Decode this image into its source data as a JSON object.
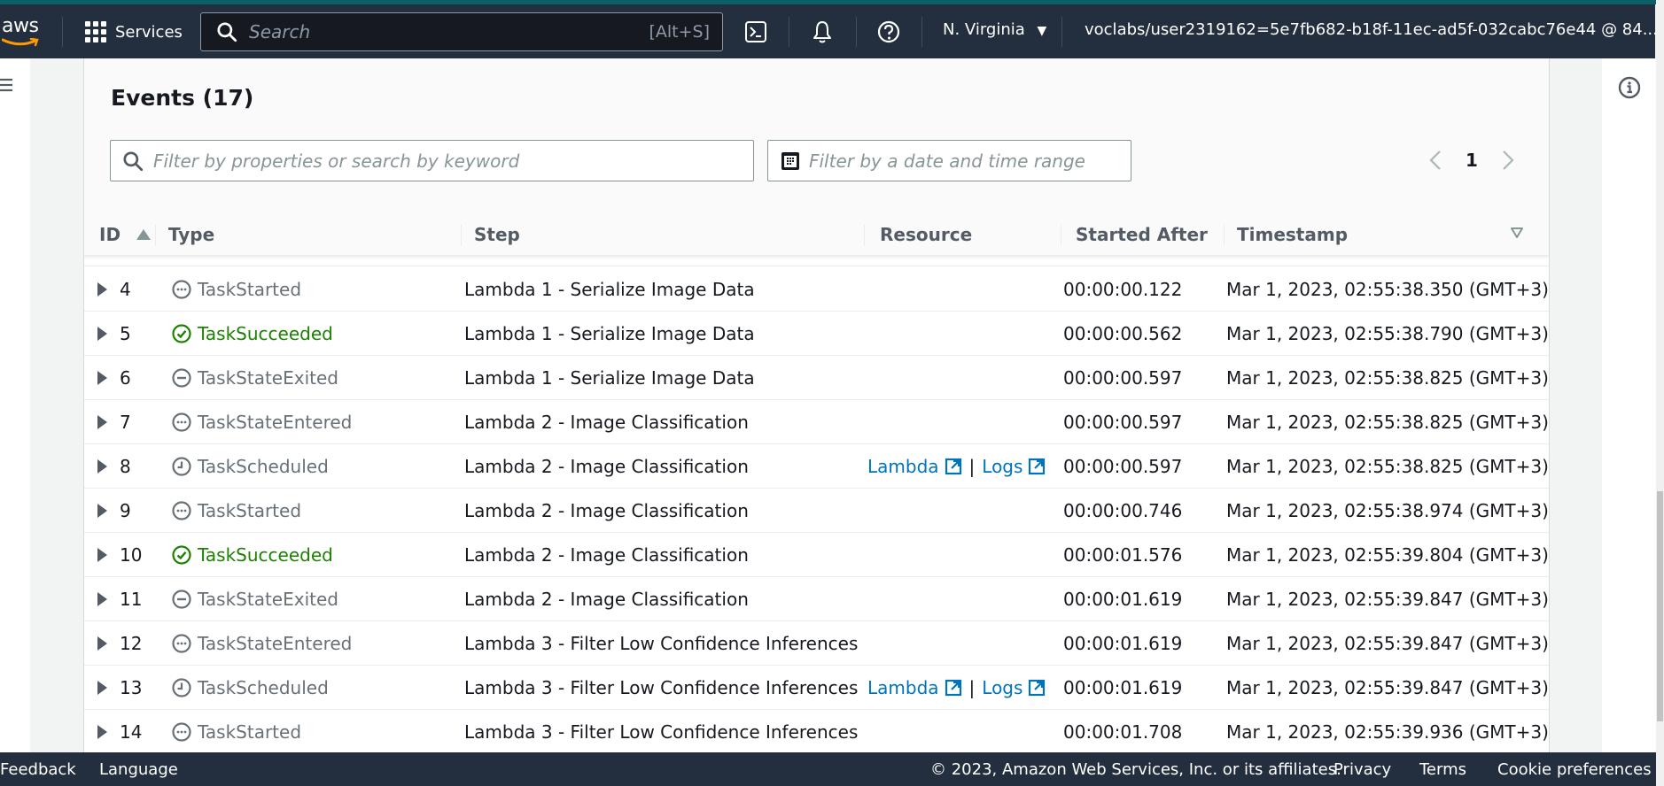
{
  "topnav": {
    "logo_text": "aws",
    "services_label": "Services",
    "search_placeholder": "Search",
    "search_shortcut": "[Alt+S]",
    "region": "N. Virginia",
    "account": "voclabs/user2319162=5e7fb682-b18f-11ec-ad5f-032cabc76e44 @ 84...",
    "icons": [
      "cloudshell-icon",
      "bell-icon",
      "help-icon"
    ]
  },
  "events": {
    "title": "Events (17)",
    "filter_placeholder": "Filter by properties or search by keyword",
    "date_filter_placeholder": "Filter by a date and time range",
    "current_page": "1",
    "columns": [
      "ID",
      "Type",
      "Step",
      "Resource",
      "Started After",
      "Timestamp"
    ],
    "sort_column": "ID",
    "sort_direction": "ascending",
    "rows": [
      {
        "id": "4",
        "type": "TaskStarted",
        "status": "in-progress",
        "step": "Lambda 1 - Serialize Image Data",
        "resource_lambda": "",
        "resource_logs": "",
        "started_after": "00:00:00.122",
        "timestamp": "Mar 1, 2023, 02:55:38.350 (GMT+3)"
      },
      {
        "id": "5",
        "type": "TaskSucceeded",
        "status": "success",
        "step": "Lambda 1 - Serialize Image Data",
        "resource_lambda": "",
        "resource_logs": "",
        "started_after": "00:00:00.562",
        "timestamp": "Mar 1, 2023, 02:55:38.790 (GMT+3)"
      },
      {
        "id": "6",
        "type": "TaskStateExited",
        "status": "exited",
        "step": "Lambda 1 - Serialize Image Data",
        "resource_lambda": "",
        "resource_logs": "",
        "started_after": "00:00:00.597",
        "timestamp": "Mar 1, 2023, 02:55:38.825 (GMT+3)"
      },
      {
        "id": "7",
        "type": "TaskStateEntered",
        "status": "in-progress",
        "step": "Lambda 2 - Image Classification",
        "resource_lambda": "",
        "resource_logs": "",
        "started_after": "00:00:00.597",
        "timestamp": "Mar 1, 2023, 02:55:38.825 (GMT+3)"
      },
      {
        "id": "8",
        "type": "TaskScheduled",
        "status": "scheduled",
        "step": "Lambda 2 - Image Classification",
        "resource_lambda": "Lambda",
        "resource_logs": "Logs",
        "started_after": "00:00:00.597",
        "timestamp": "Mar 1, 2023, 02:55:38.825 (GMT+3)"
      },
      {
        "id": "9",
        "type": "TaskStarted",
        "status": "in-progress",
        "step": "Lambda 2 - Image Classification",
        "resource_lambda": "",
        "resource_logs": "",
        "started_after": "00:00:00.746",
        "timestamp": "Mar 1, 2023, 02:55:38.974 (GMT+3)"
      },
      {
        "id": "10",
        "type": "TaskSucceeded",
        "status": "success",
        "step": "Lambda 2 - Image Classification",
        "resource_lambda": "",
        "resource_logs": "",
        "started_after": "00:00:01.576",
        "timestamp": "Mar 1, 2023, 02:55:39.804 (GMT+3)"
      },
      {
        "id": "11",
        "type": "TaskStateExited",
        "status": "exited",
        "step": "Lambda 2 - Image Classification",
        "resource_lambda": "",
        "resource_logs": "",
        "started_after": "00:00:01.619",
        "timestamp": "Mar 1, 2023, 02:55:39.847 (GMT+3)"
      },
      {
        "id": "12",
        "type": "TaskStateEntered",
        "status": "in-progress",
        "step": "Lambda 3 - Filter Low Confidence Inferences",
        "resource_lambda": "",
        "resource_logs": "",
        "started_after": "00:00:01.619",
        "timestamp": "Mar 1, 2023, 02:55:39.847 (GMT+3)"
      },
      {
        "id": "13",
        "type": "TaskScheduled",
        "status": "scheduled",
        "step": "Lambda 3 - Filter Low Confidence Inferences",
        "resource_lambda": "Lambda",
        "resource_logs": "Logs",
        "started_after": "00:00:01.619",
        "timestamp": "Mar 1, 2023, 02:55:39.847 (GMT+3)"
      },
      {
        "id": "14",
        "type": "TaskStarted",
        "status": "in-progress",
        "step": "Lambda 3 - Filter Low Confidence Inferences",
        "resource_lambda": "",
        "resource_logs": "",
        "started_after": "00:00:01.708",
        "timestamp": "Mar 1, 2023, 02:55:39.936 (GMT+3)"
      }
    ],
    "resource_separator": "|"
  },
  "colors": {
    "nav_bg": "#232f3e",
    "accent_teal": "#0b6068",
    "link": "#0073bb",
    "success": "#1d8102",
    "muted": "#687078"
  },
  "footer": {
    "feedback": "Feedback",
    "language": "Language",
    "copyright": "© 2023, Amazon Web Services, Inc. or its affiliates.",
    "privacy": "Privacy",
    "terms": "Terms",
    "cookie": "Cookie preferences"
  }
}
